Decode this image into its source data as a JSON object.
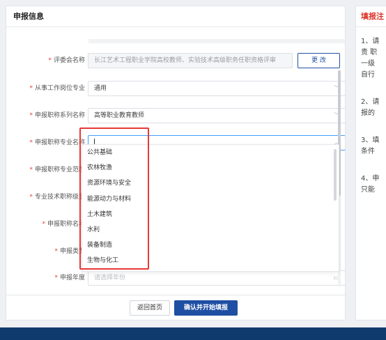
{
  "form": {
    "title": "申报信息",
    "committee": {
      "label": "评委会名称",
      "value": "长江艺术工程职业学院高校教师、实验技术高级职务任职资格评审",
      "change_label": "更 改"
    },
    "major": {
      "label": "从事工作岗位专业",
      "value": "通用"
    },
    "series": {
      "label": "申报职称系列名称",
      "value": "高等职业教育教师"
    },
    "specialty": {
      "label": "申报职称专业名称",
      "value": ""
    },
    "scope": {
      "label": "申报职称专业范围"
    },
    "level": {
      "label": "专业技术职称级别"
    },
    "title_name": {
      "label": "申报职称名称"
    },
    "type": {
      "label": "申报类型"
    },
    "year": {
      "label": "申报年度",
      "placeholder": "请选择年份"
    },
    "back_label": "返回首页",
    "start_label": "确认并开始填报"
  },
  "dropdown": {
    "options": [
      "公共基础",
      "农林牧渔",
      "资源环境与安全",
      "能源动力与材料",
      "土木建筑",
      "水利",
      "装备制造",
      "生物与化工"
    ]
  },
  "notes": {
    "title": "填报注",
    "items": [
      "1、请",
      "责 职",
      "一级",
      "自行",
      "2、请",
      "报的",
      "3、填",
      "条件",
      "4、申",
      "只能"
    ]
  },
  "colors": {
    "primary": "#1f4fa3",
    "required": "#e23b3b",
    "highlight": "#e53935",
    "bottom_bar": "#0e3a6e"
  }
}
